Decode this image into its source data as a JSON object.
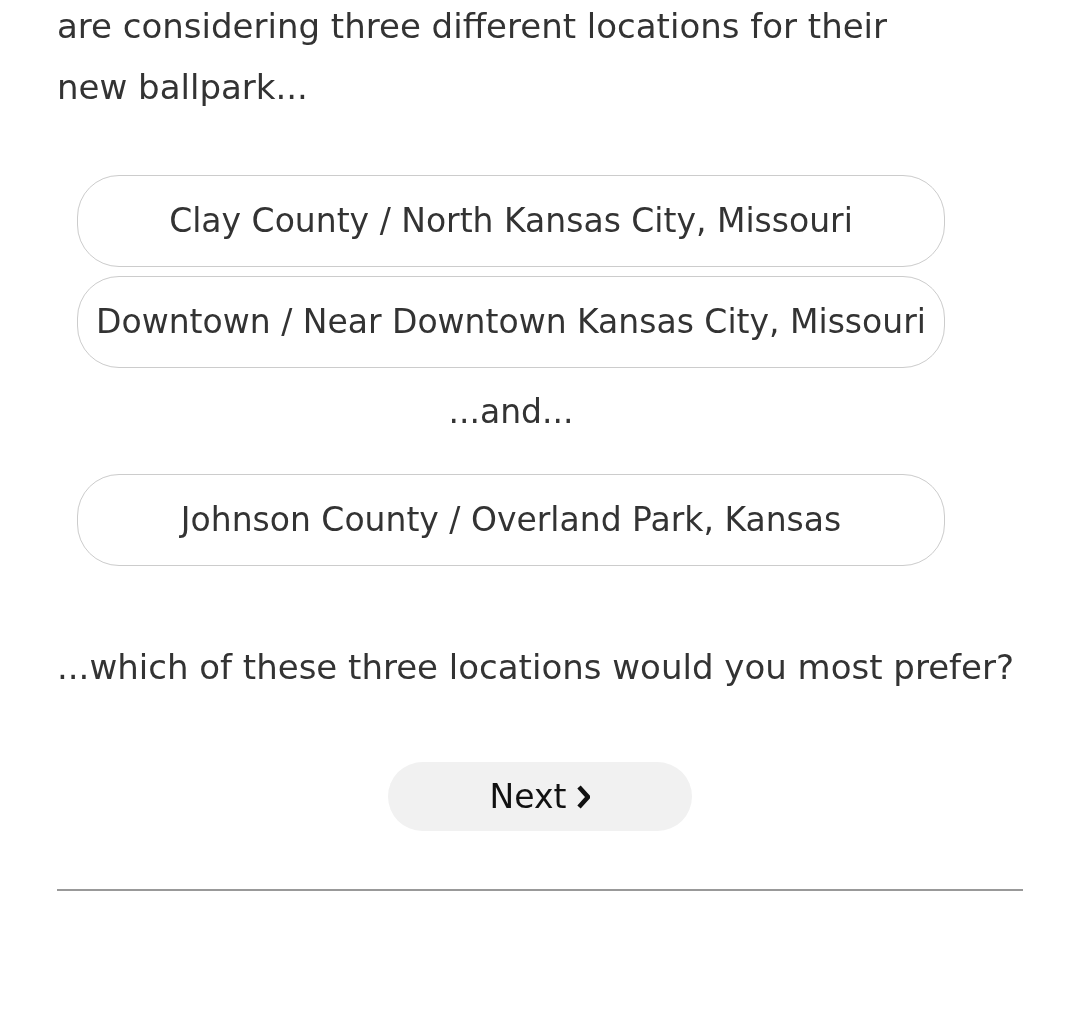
{
  "intro": "are considering three different locations for their new ballpark...",
  "options": [
    {
      "kind": "option",
      "label": "Clay County / North Kansas City, Missouri",
      "selected": false
    },
    {
      "kind": "option",
      "label": "Downtown / Near Downtown Kansas City, Missouri",
      "selected": false
    },
    {
      "kind": "separator",
      "label": "...and..."
    },
    {
      "kind": "option",
      "label": "Johnson County / Overland Park, Kansas",
      "selected": false
    }
  ],
  "question": "...which of these three locations would you most prefer?",
  "next_button": {
    "label": "Next"
  }
}
